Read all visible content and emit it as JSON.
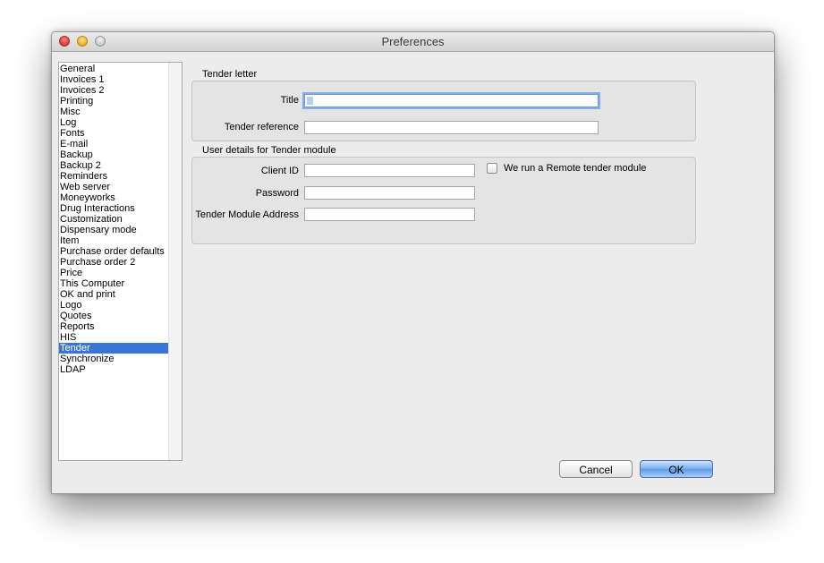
{
  "window": {
    "title": "Preferences"
  },
  "sidebar": {
    "items": [
      {
        "label": "General"
      },
      {
        "label": "Invoices 1"
      },
      {
        "label": "Invoices 2"
      },
      {
        "label": "Printing"
      },
      {
        "label": "Misc"
      },
      {
        "label": "Log"
      },
      {
        "label": "Fonts"
      },
      {
        "label": "E-mail"
      },
      {
        "label": "Backup"
      },
      {
        "label": "Backup 2"
      },
      {
        "label": "Reminders"
      },
      {
        "label": "Web server"
      },
      {
        "label": "Moneyworks"
      },
      {
        "label": "Drug Interactions"
      },
      {
        "label": "Customization"
      },
      {
        "label": "Dispensary mode"
      },
      {
        "label": "Item"
      },
      {
        "label": "Purchase order defaults"
      },
      {
        "label": "Purchase order 2"
      },
      {
        "label": "Price"
      },
      {
        "label": "This Computer"
      },
      {
        "label": "OK and print"
      },
      {
        "label": "Logo"
      },
      {
        "label": "Quotes"
      },
      {
        "label": "Reports"
      },
      {
        "label": "HIS"
      },
      {
        "label": "Tender",
        "selected": true
      },
      {
        "label": "Synchronize"
      },
      {
        "label": "LDAP"
      }
    ]
  },
  "tender_letter": {
    "heading": "Tender letter",
    "title_label": "Title",
    "title_value": "",
    "reference_label": "Tender reference",
    "reference_value": ""
  },
  "user_details": {
    "heading": "User details for Tender module",
    "client_id_label": "Client ID",
    "client_id_value": "",
    "password_label": "Password",
    "password_value": "",
    "address_label": "Tender Module Address",
    "address_value": "",
    "remote_checkbox_label": "We run a Remote tender module",
    "remote_checked": false
  },
  "buttons": {
    "cancel": "Cancel",
    "ok": "OK"
  },
  "colors": {
    "selection": "#3875d7",
    "focus_ring": "#84aef0",
    "default_button": "#77adf0"
  }
}
